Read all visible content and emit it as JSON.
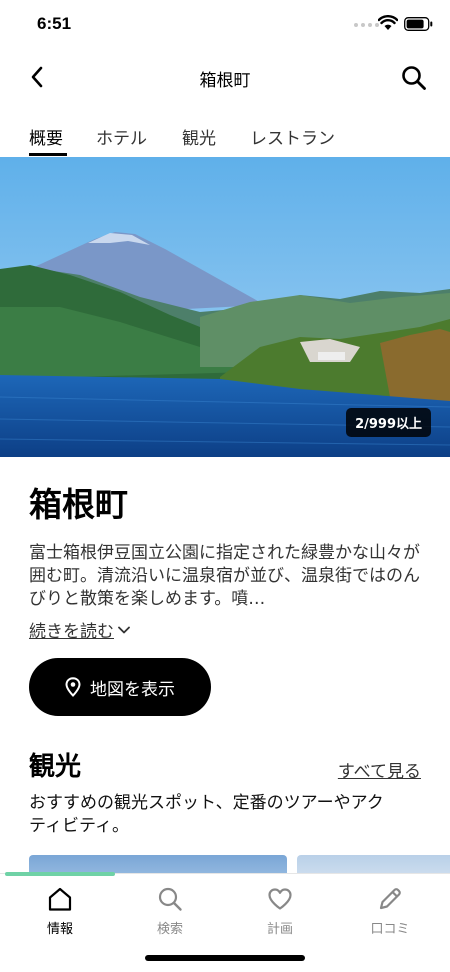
{
  "status_bar": {
    "time": "6:51"
  },
  "nav": {
    "title": "箱根町"
  },
  "tabs": [
    {
      "label": "概要",
      "active": true
    },
    {
      "label": "ホテル",
      "active": false
    },
    {
      "label": "観光",
      "active": false
    },
    {
      "label": "レストラン",
      "active": false
    }
  ],
  "hero": {
    "photo_counter": "2/999以上"
  },
  "place": {
    "title": "箱根町",
    "description": "富士箱根伊豆国立公園に指定された緑豊かな山々が囲む町。清流沿いに温泉宿が並び、温泉街ではのんびりと散策を楽しめます。噴…",
    "read_more": "続きを読む"
  },
  "map_button": {
    "label": "地図を表示"
  },
  "sightseeing": {
    "title": "観光",
    "see_all": "すべて見る",
    "description": "おすすめの観光スポット、定番のツアーやアクティビティ。"
  },
  "bottom_tabs": [
    {
      "label": "情報",
      "icon": "home-icon",
      "active": true
    },
    {
      "label": "検索",
      "icon": "search-icon",
      "active": false
    },
    {
      "label": "計画",
      "icon": "heart-icon",
      "active": false
    },
    {
      "label": "口コミ",
      "icon": "pencil-icon",
      "active": false
    }
  ],
  "colors": {
    "accent": "#6fd2a6",
    "text": "#000000",
    "muted": "#888888"
  }
}
